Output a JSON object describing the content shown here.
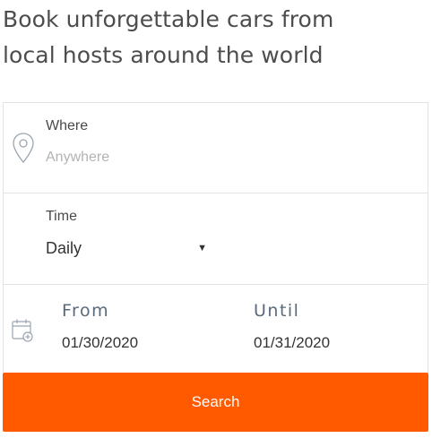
{
  "headline": {
    "line1": "Book unforgettable cars from",
    "line2": "local hosts around the world"
  },
  "search_form": {
    "where": {
      "label": "Where",
      "placeholder": "Anywhere",
      "value": "",
      "icon": "location-pin-icon"
    },
    "time": {
      "label": "Time",
      "selected": "Daily",
      "caret": "▼"
    },
    "dates": {
      "icon": "calendar-add-icon",
      "from_label": "From",
      "from_value": "01/30/2020",
      "until_label": "Until",
      "until_value": "01/31/2020"
    },
    "search_button_label": "Search"
  },
  "colors": {
    "accent": "#ff5a00",
    "border": "#e3e3e3",
    "placeholder": "#b3b3b3",
    "icon": "#9aa5b1"
  }
}
